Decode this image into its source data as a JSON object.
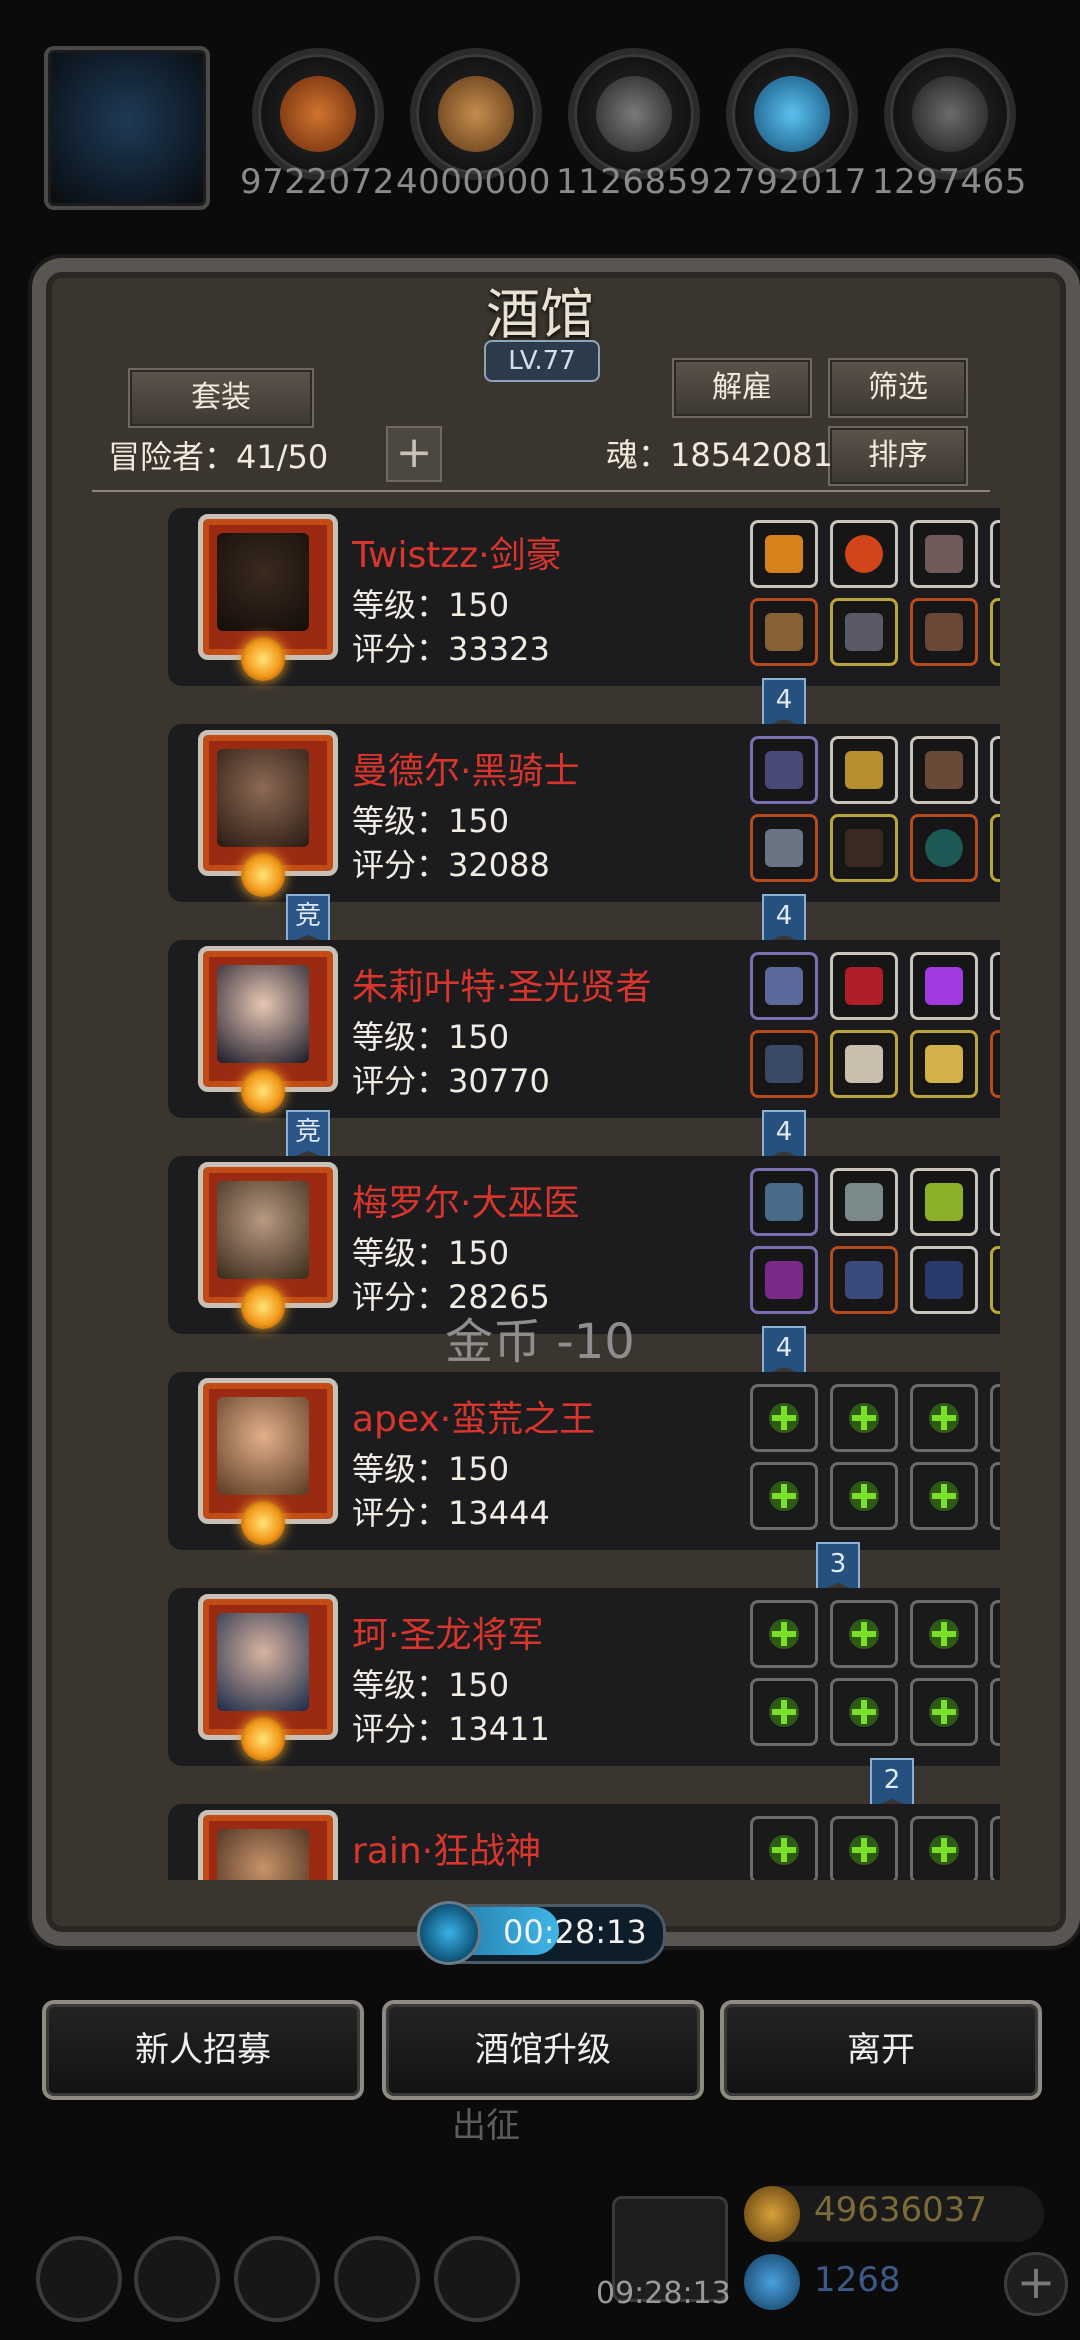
{
  "resources": [
    {
      "name": "resource-1",
      "value": "9722072",
      "color": "#b5561f"
    },
    {
      "name": "resource-2",
      "value": "4000000",
      "color": "#a5713a"
    },
    {
      "name": "resource-3",
      "value": "1126859",
      "color": "#5a5a5a"
    },
    {
      "name": "resource-4",
      "value": "2792017",
      "color": "#2a8ec4"
    },
    {
      "name": "resource-5",
      "value": "1297465",
      "color": "#4a4a4a"
    }
  ],
  "tavern": {
    "title": "酒馆",
    "level": "LV.77",
    "set_button": "套装",
    "dismiss_button": "解雇",
    "filter_button": "筛选",
    "sort_button": "排序",
    "adventurers_label": "冒险者：41/50",
    "soul_label": "魂：18542081",
    "plus": "+"
  },
  "heroes": [
    {
      "name": "Twistzz·剑豪",
      "level": "等级：150",
      "score": "评分：33323",
      "badge": "4",
      "comp": ""
    },
    {
      "name": "曼德尔·黑骑士",
      "level": "等级：150",
      "score": "评分：32088",
      "badge": "4",
      "comp": "竞"
    },
    {
      "name": "朱莉叶特·圣光贤者",
      "level": "等级：150",
      "score": "评分：30770",
      "badge": "4",
      "comp": "竞"
    },
    {
      "name": "梅罗尔·大巫医",
      "level": "等级：150",
      "score": "评分：28265",
      "badge": "4",
      "comp": ""
    },
    {
      "name": "apex·蛮荒之王",
      "level": "等级：150",
      "score": "评分：13444",
      "badge": "3",
      "comp": ""
    },
    {
      "name": "珂·圣龙将军",
      "level": "等级：150",
      "score": "评分：13411",
      "badge": "2",
      "comp": ""
    },
    {
      "name": "rain·狂战神",
      "level": "",
      "score": "",
      "badge": "",
      "comp": ""
    }
  ],
  "floating_text": "金币 -10",
  "timer": "00:28:13",
  "buttons": {
    "recruit": "新人招募",
    "upgrade": "酒馆升级",
    "leave": "离开"
  },
  "background": {
    "dispatch": "出征",
    "clock": "09:28:13",
    "gold": "49636037",
    "gems": "1268"
  }
}
